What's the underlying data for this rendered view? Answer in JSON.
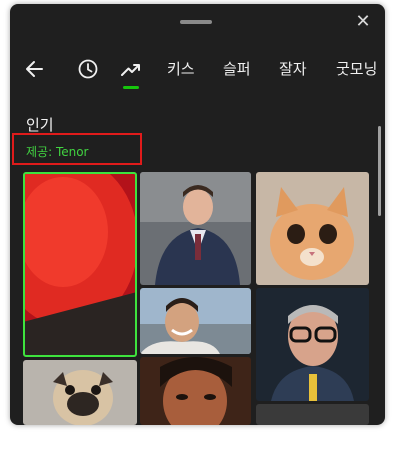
{
  "header": {
    "close_glyph": "✕"
  },
  "nav": {
    "back_icon": "arrow-left-icon",
    "recent_icon": "clock-icon",
    "trending_icon": "trending-up-icon",
    "tabs": [
      "키스",
      "슬퍼",
      "잘자",
      "굿모닝"
    ],
    "active_color": "#16c60c"
  },
  "section": {
    "title": "인기",
    "provider": "제공: Tenor"
  },
  "gifs": [
    {
      "name": "gif-red-abstract",
      "selected": true
    },
    {
      "name": "gif-man-in-suit",
      "selected": false
    },
    {
      "name": "gif-kitten",
      "selected": false
    },
    {
      "name": "gif-smiling-man",
      "selected": false
    },
    {
      "name": "gif-man-glasses",
      "selected": false
    },
    {
      "name": "gif-pug",
      "selected": false
    },
    {
      "name": "gif-man-face",
      "selected": false
    }
  ],
  "colors": {
    "panel_bg": "#1f1f1f",
    "highlight_border": "#e01b1b",
    "provider_text": "#41d241",
    "selection_outline": "#3ee33e"
  }
}
